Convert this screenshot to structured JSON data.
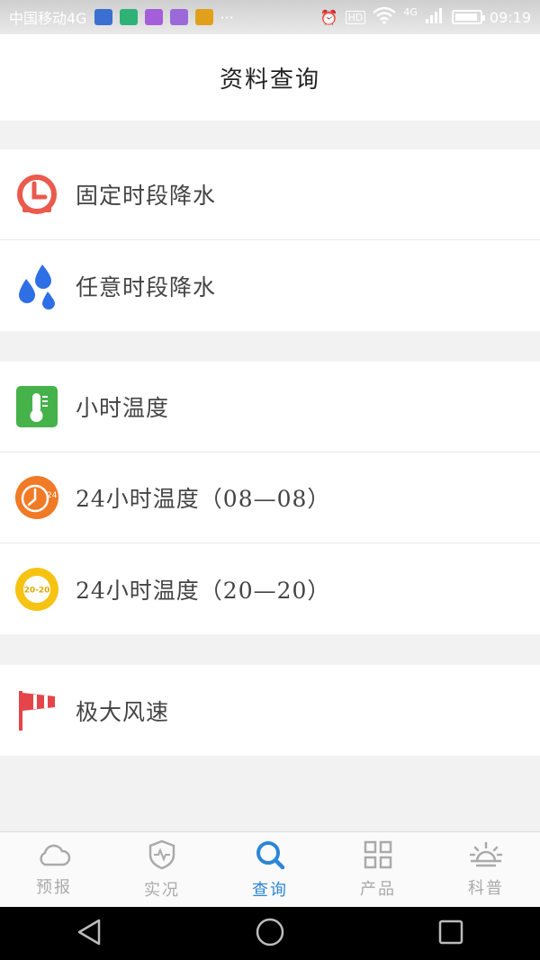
{
  "status_bar": {
    "carrier": "中国移动4G",
    "more": "···",
    "hd": "HD",
    "network": "4G",
    "time": "09:19"
  },
  "header": {
    "title": "资料查询"
  },
  "groups": [
    {
      "items": [
        {
          "label": "固定时段降水",
          "icon": "clock-icon",
          "color": "#ea5a4d"
        },
        {
          "label": "任意时段降水",
          "icon": "raindrops-icon",
          "color": "#2f6fe6"
        }
      ]
    },
    {
      "items": [
        {
          "label": "小时温度",
          "icon": "thermometer-icon",
          "color": "#45b24a"
        },
        {
          "label": "24小时温度（08—08）",
          "icon": "clock-24-icon",
          "color": "#f07a26"
        },
        {
          "label": "24小时温度（20—20）",
          "icon": "badge-20-20-icon",
          "color": "#f6c312",
          "icon_text": "20-20"
        }
      ]
    },
    {
      "items": [
        {
          "label": "极大风速",
          "icon": "windsock-icon",
          "color": "#e5454a"
        }
      ]
    }
  ],
  "tabs": [
    {
      "label": "预报",
      "icon": "cloud-icon",
      "active": false
    },
    {
      "label": "实况",
      "icon": "shield-pulse-icon",
      "active": false
    },
    {
      "label": "查询",
      "icon": "search-icon",
      "active": true
    },
    {
      "label": "产品",
      "icon": "grid-icon",
      "active": false
    },
    {
      "label": "科普",
      "icon": "sunrise-icon",
      "active": false
    }
  ],
  "colors": {
    "accent": "#2c86d6",
    "inactive": "#aaaaaa"
  }
}
